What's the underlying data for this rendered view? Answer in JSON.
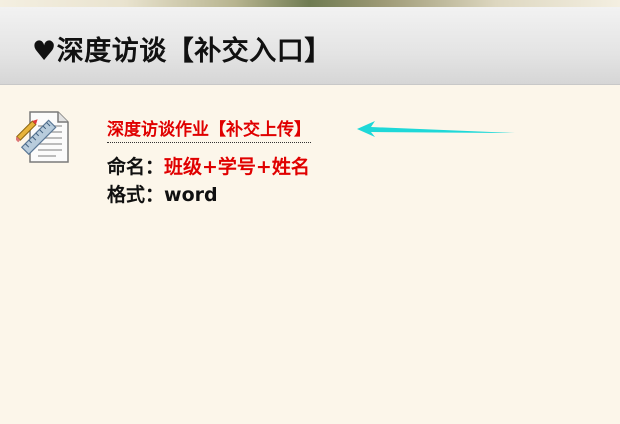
{
  "header": {
    "title": "♥深度访谈【补交入口】"
  },
  "assignment": {
    "link_label": "深度访谈作业【补交上传】",
    "icon": "document-ruler-icon"
  },
  "instructions": {
    "naming_label": "命名：",
    "naming_value": "班级+学号+姓名",
    "format_label": "格式：",
    "format_value": "word"
  },
  "colors": {
    "accent_red": "#e00000",
    "arrow_cyan": "#1ed8d8",
    "background": "#fcf6ea"
  }
}
